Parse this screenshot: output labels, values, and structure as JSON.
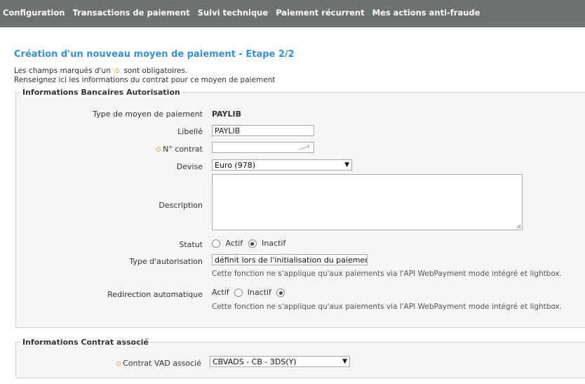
{
  "nav": {
    "items": [
      "Configuration",
      "Transactions de paiement",
      "Suivi technique",
      "Paiement récurrent",
      "Mes actions anti-fraude"
    ]
  },
  "page": {
    "title": "Création d'un nouveau moyen de paiement - Etape 2/2",
    "required_hint_before": "Les champs marqués d'un",
    "required_hint_after": "sont obligatoires.",
    "instructions": "Renseignez ici les informations du contrat pour ce moyen de paiement"
  },
  "bank_section": {
    "legend": "Informations Bancaires Autorisation",
    "payment_type_label": "Type de moyen de paiement",
    "payment_type_value": "PAYLIB",
    "libelle_label": "Libellé",
    "libelle_value": "PAYLIB",
    "contract_label": "N° contrat",
    "contract_value": "",
    "currency_label": "Devise",
    "currency_value": "Euro (978)",
    "description_label": "Description",
    "description_value": "",
    "status_label": "Statut",
    "status_options": [
      "Actif",
      "Inactif"
    ],
    "status_selected": "Inactif",
    "auth_type_label": "Type d'autorisation",
    "auth_type_value": "définit lors de l'initialisation du paiement",
    "auth_type_note": "Cette fonction ne s'applique qu'aux paiements via l'API WebPayment mode intégré et lightbox.",
    "redirect_label": "Redirection automatique",
    "redirect_options": [
      "Actif",
      "Inactif"
    ],
    "redirect_selected": "Inactif",
    "redirect_note": "Cette fonction ne s'applique qu'aux paiements via l'API WebPayment mode intégré et lightbox."
  },
  "contract_section": {
    "legend": "Informations Contrat associé",
    "vad_label": "Contrat VAD associé",
    "vad_value": "CBVADS - CB - 3DS(Y)"
  },
  "colors": {
    "nav_bg": "#6e7172",
    "title": "#3a8fd0",
    "required_dot": "#e0a030",
    "panel_bg": "#f5f5f5"
  }
}
